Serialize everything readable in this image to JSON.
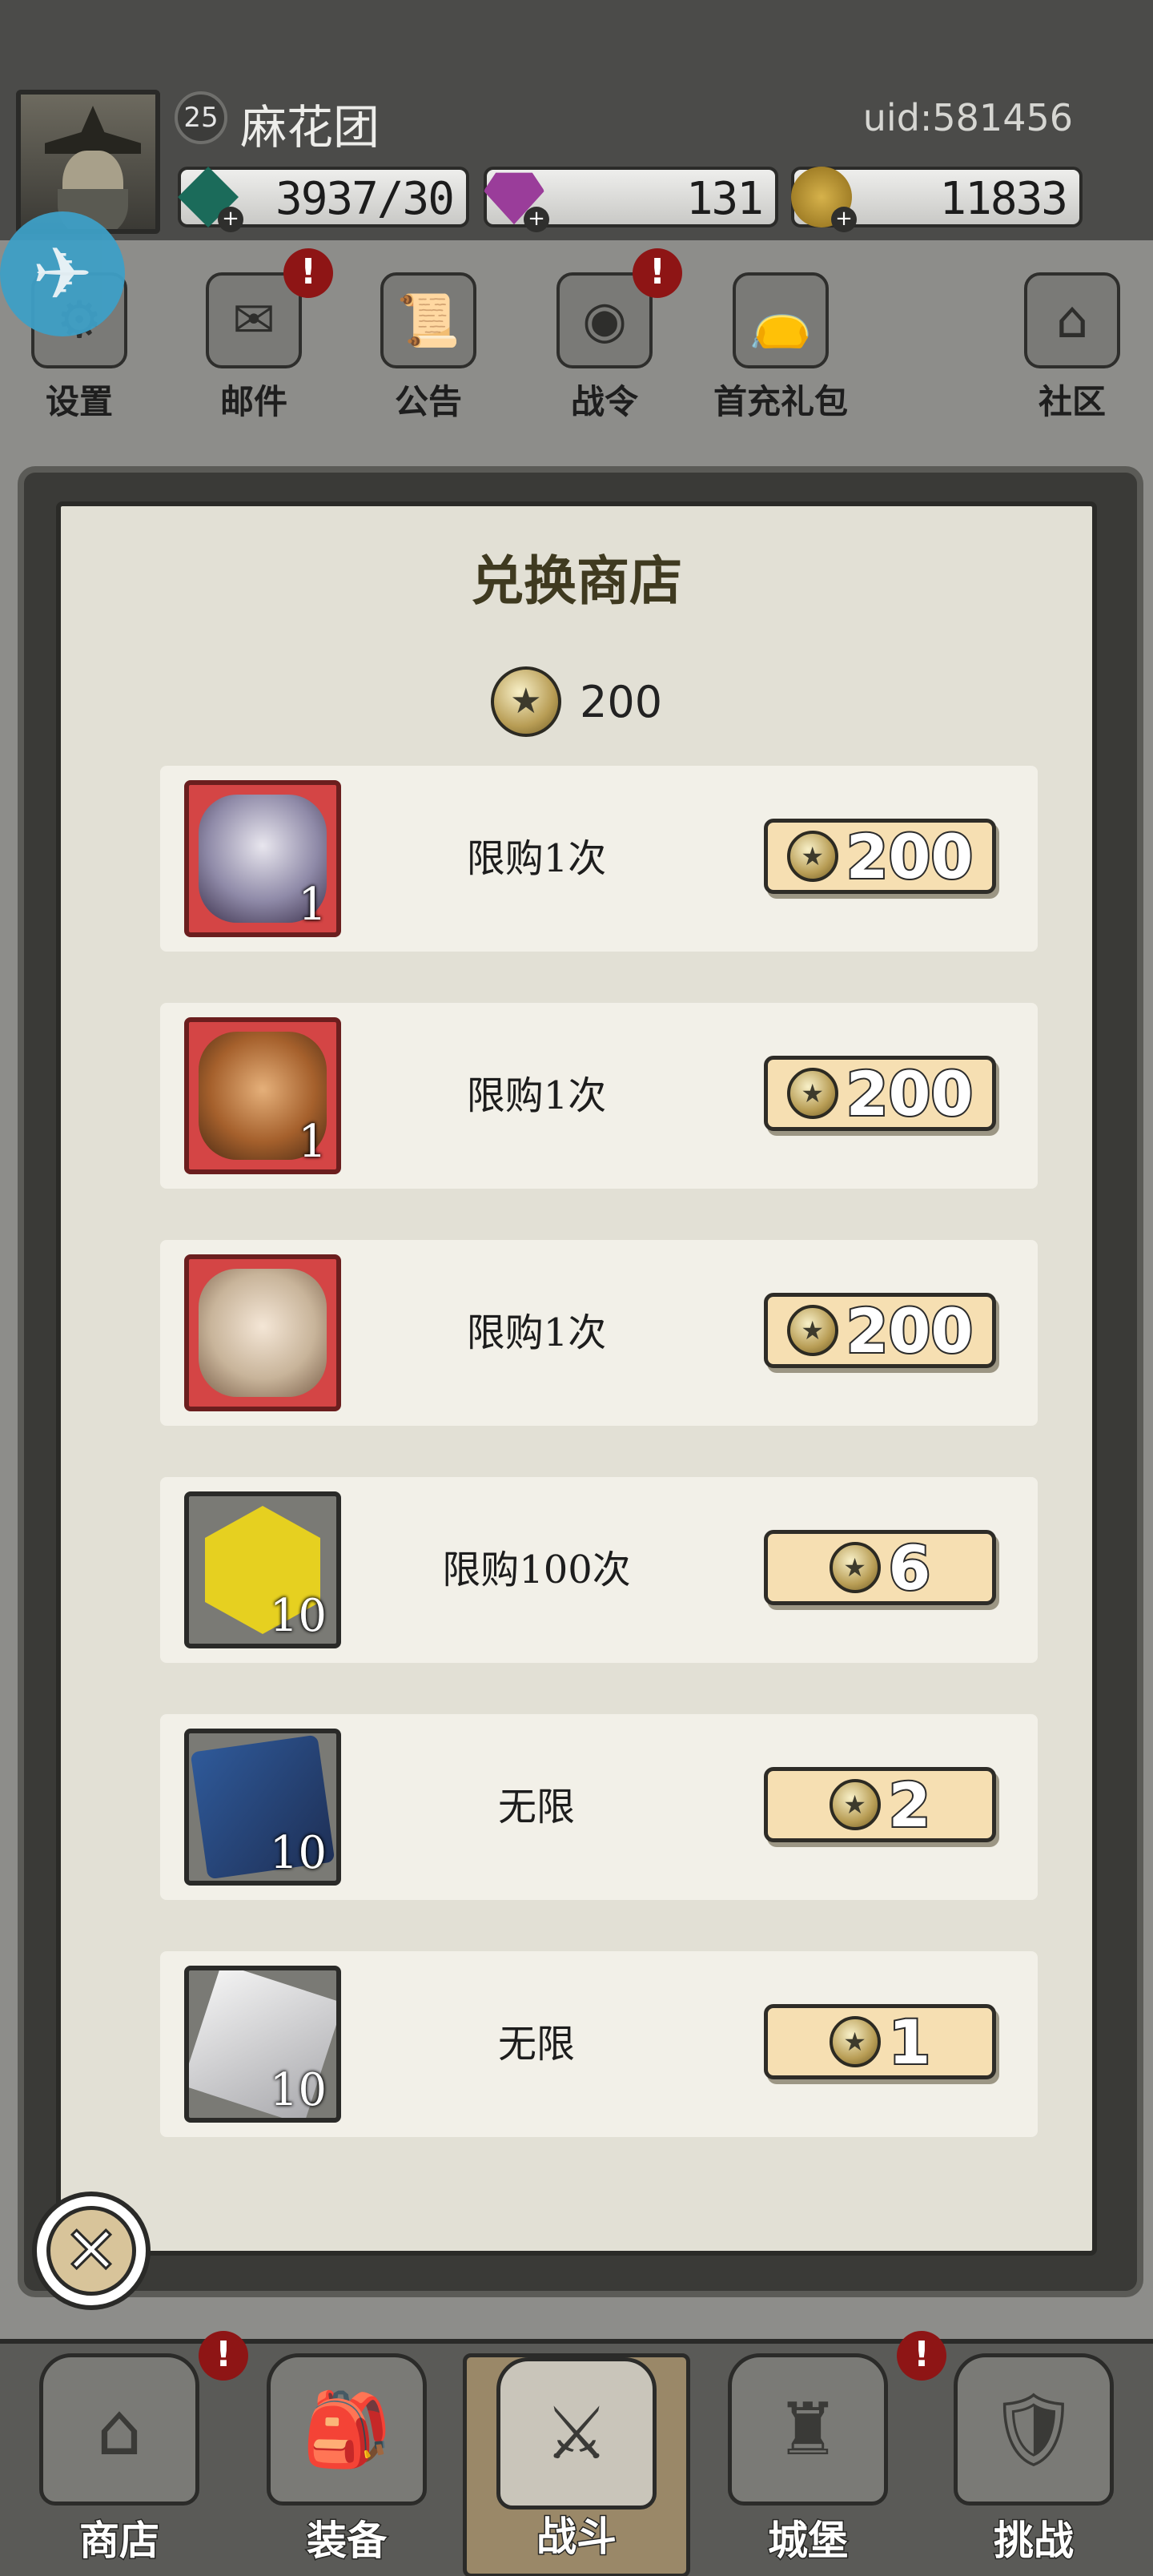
{
  "player": {
    "level": "25",
    "name": "麻花团",
    "uid": "uid:581456"
  },
  "resources": [
    {
      "icon": "emerald-gem-icon",
      "value": "3937/30"
    },
    {
      "icon": "purple-diamond-icon",
      "value": "131"
    },
    {
      "icon": "gold-coin-icon",
      "value": "11833"
    }
  ],
  "nav": {
    "settings": "设置",
    "mail": "邮件",
    "notice": "公告",
    "battlepass": "战令",
    "first_recharge": "首充礼包",
    "community": "社区",
    "alert": "!"
  },
  "dialog": {
    "title": "兑换商店",
    "coin_balance": "200",
    "items": [
      {
        "thumb": "hero-sorceress-portrait",
        "qty": "1",
        "limit": "限购1次",
        "price": "200"
      },
      {
        "thumb": "hero-monkey-king-portrait",
        "qty": "1",
        "limit": "限购1次",
        "price": "200"
      },
      {
        "thumb": "hero-old-sage-portrait",
        "qty": "1",
        "limit": "限购1次",
        "price": "200"
      },
      {
        "thumb": "yellow-crystal-icon",
        "qty": "10",
        "limit": "限购100次",
        "price": "6"
      },
      {
        "thumb": "blue-spellbook-icon",
        "qty": "10",
        "limit": "无限",
        "price": "2"
      },
      {
        "thumb": "silver-ore-icon",
        "qty": "10",
        "limit": "无限",
        "price": "1"
      }
    ],
    "close_symbol": "✕"
  },
  "tabs": [
    {
      "label": "商店",
      "alert": "!"
    },
    {
      "label": "装备",
      "alert": ""
    },
    {
      "label": "战斗",
      "alert": ""
    },
    {
      "label": "城堡",
      "alert": "!"
    },
    {
      "label": "挑战",
      "alert": ""
    }
  ],
  "colors": {
    "accent_badge": "#8e1515",
    "price_button": "#f6dfb2",
    "hero_frame": "#d44545",
    "dialog_bg": "#e2e0d5"
  }
}
